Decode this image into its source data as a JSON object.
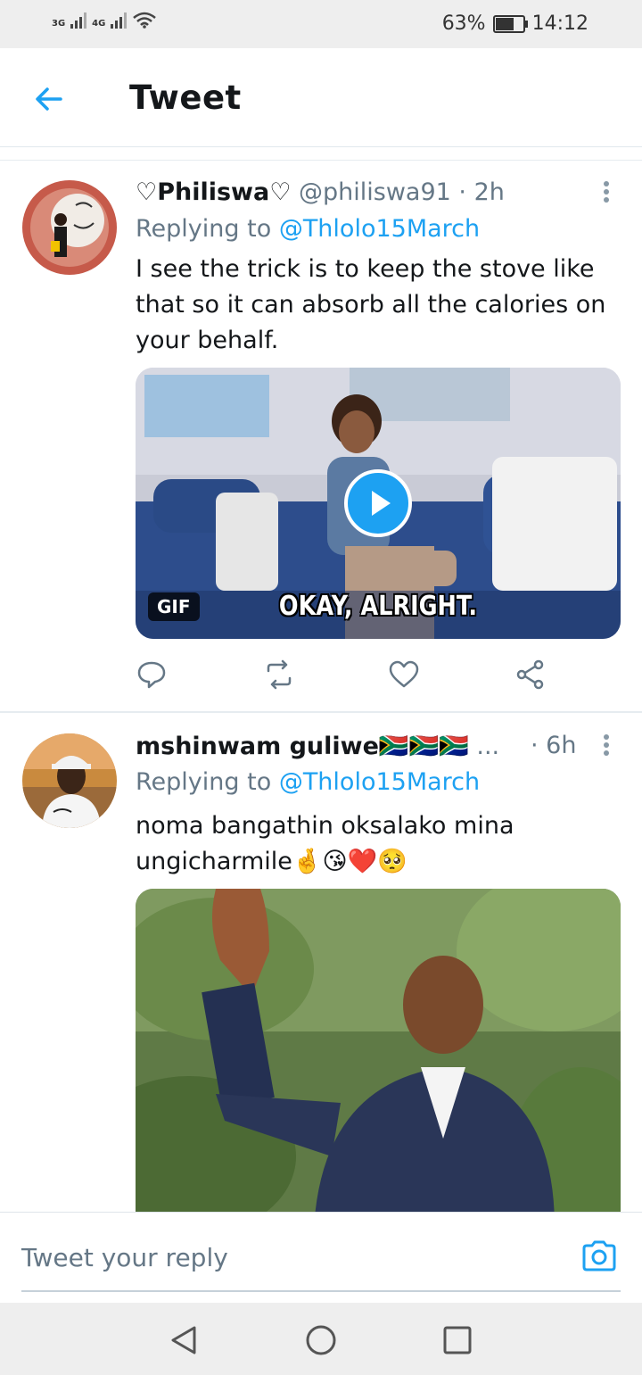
{
  "status_bar": {
    "net1": "3G",
    "net2": "4G",
    "battery_text": "63%",
    "battery_level": 0.63,
    "time": "14:12",
    "icons": [
      "signal-icon",
      "wifi-icon",
      "battery-icon"
    ]
  },
  "header": {
    "title": "Tweet",
    "back_icon": "arrow-left-icon",
    "accent": "#1da1f2"
  },
  "tweets": [
    {
      "name": "♡Philiswa♡",
      "handle": "@philiswa91",
      "time": "· 2h",
      "replying_prefix": "Replying to",
      "replying_to": "@Thlolo15March",
      "text": "I see the trick is to keep the stove like that so it can absorb all the calories on your behalf.",
      "media": {
        "badge": "GIF",
        "caption": "OKAY, ALRIGHT."
      },
      "actions": [
        "reply-icon",
        "retweet-icon",
        "like-icon",
        "share-icon"
      ]
    },
    {
      "name": "mshinwam guliwe🇿🇦🇿🇦🇿🇦",
      "ellipsis": "...",
      "time": "· 6h",
      "replying_prefix": "Replying to",
      "replying_to": "@Thlolo15March",
      "text": "noma bangathin oksalako mina ungicharmile🤞😘❤️🥺"
    }
  ],
  "composer": {
    "placeholder": "Tweet your reply",
    "icon": "camera-icon"
  },
  "nav": [
    "back-nav-icon",
    "home-nav-icon",
    "recents-nav-icon"
  ]
}
